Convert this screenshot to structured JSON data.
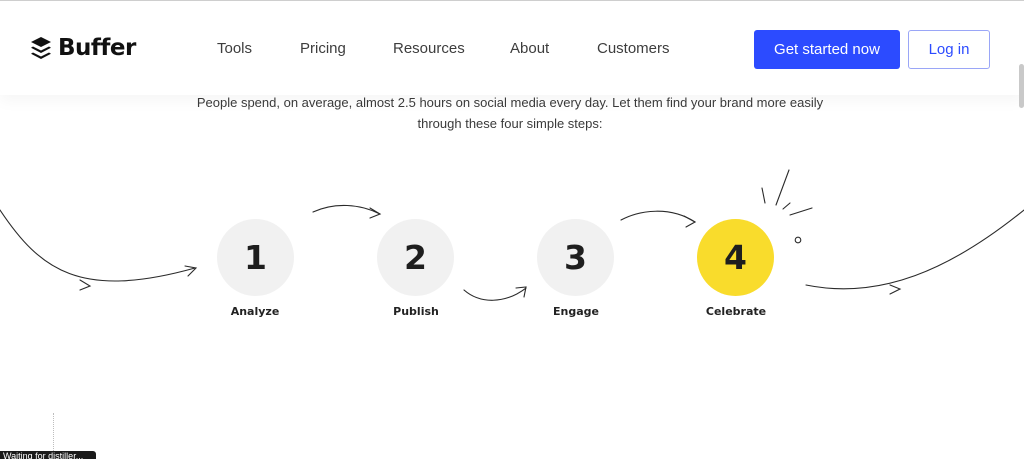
{
  "brand": {
    "name": "Buffer",
    "icon": "buffer-stack-icon"
  },
  "nav": {
    "items": [
      {
        "label": "Tools"
      },
      {
        "label": "Pricing"
      },
      {
        "label": "Resources"
      },
      {
        "label": "About"
      },
      {
        "label": "Customers"
      }
    ]
  },
  "actions": {
    "get_started_label": "Get started now",
    "login_label": "Log in"
  },
  "intro": {
    "line1": "People spend, on average, almost 2.5 hours on social media every day. Let them find your brand more easily",
    "line2": "through these four simple steps:"
  },
  "steps": [
    {
      "number": "1",
      "label": "Analyze"
    },
    {
      "number": "2",
      "label": "Publish"
    },
    {
      "number": "3",
      "label": "Engage"
    },
    {
      "number": "4",
      "label": "Celebrate"
    }
  ],
  "status": {
    "text": "Waiting for distiller..."
  },
  "colors": {
    "primary": "#2c4bff",
    "highlight": "#f9dc2c",
    "circle": "#f1f1f1",
    "text": "#3d3d3d"
  }
}
